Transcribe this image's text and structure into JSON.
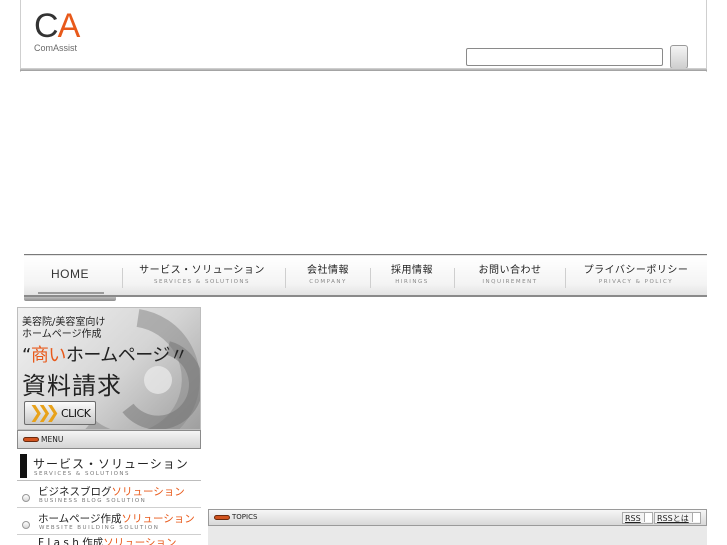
{
  "header": {
    "logo_c": "C",
    "logo_a": "A",
    "logo_sub": "ComAssist",
    "search_placeholder": ""
  },
  "global_nav": {
    "items": [
      {
        "jp": "HOME",
        "en": ""
      },
      {
        "jp": "サービス・ソリューション",
        "en": "SERVICES & SOLUTIONS"
      },
      {
        "jp": "会社情報",
        "en": "COMPANY"
      },
      {
        "jp": "採用情報",
        "en": "HIRINGS"
      },
      {
        "jp": "お問い合わせ",
        "en": "INQUIREMENT"
      },
      {
        "jp": "プライバシーポリシー",
        "en": "PRIVACY & POLICY"
      }
    ]
  },
  "banner": {
    "line1": "美容院/美容室向け",
    "line2": "ホームページ作成",
    "line3_open": "“",
    "line3_highlight": "商い",
    "line3_rest": "ホームページ〃",
    "line4": "資料請求",
    "click_label": "CLICK"
  },
  "menu": {
    "header_label": "MENU",
    "main": {
      "jp": "サービス・ソリューション",
      "en": "SERVICES & SOLUTIONS"
    },
    "items": [
      {
        "jp": "ビジネスブログ",
        "jp_accent": "ソリューション",
        "en": "BUSINESS BLOG SOLUTION"
      },
      {
        "jp": "ホームページ作成",
        "jp_accent": "ソリューション",
        "en": "WEBSITE BUILDING SOLUTION"
      },
      {
        "jp": "F l a s h 作成",
        "jp_accent": "ソリューション",
        "en": ""
      }
    ]
  },
  "topics": {
    "label": "TOPICS",
    "rss_label": "RSS",
    "rss_about_label": "RSSとは"
  },
  "colors": {
    "accent": "#e8591a",
    "pill": "#d2541f"
  }
}
